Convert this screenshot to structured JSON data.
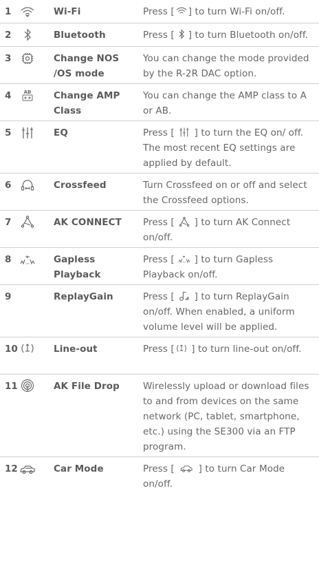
{
  "rows": [
    {
      "num": "1",
      "icon": "wifi-icon",
      "name": "Wi-Fi",
      "desc_pre": "Press [",
      "desc_post": "] to turn Wi-Fi on/off."
    },
    {
      "num": "2",
      "icon": "bluetooth-icon",
      "name": "Bluetooth",
      "desc_pre": "Press [",
      "desc_post": "] to turn Bluetooth on/off."
    },
    {
      "num": "3",
      "icon": "chip-icon",
      "name": "Change NOS /OS mode",
      "desc": "You can change the mode provided by the R-2R DAC option."
    },
    {
      "num": "4",
      "icon": "amp-class-icon",
      "name": "Change AMP Class",
      "desc": "You can change the AMP class to A or AB."
    },
    {
      "num": "5",
      "icon": "eq-icon",
      "name": "EQ",
      "desc_pre": "Press [",
      "desc_post": "] to turn the EQ on/ off. The most recent EQ settings are applied by default."
    },
    {
      "num": "6",
      "icon": "crossfeed-icon",
      "name": "Crossfeed",
      "desc": "Turn Crossfeed on or off and select the Crossfeed options."
    },
    {
      "num": "7",
      "icon": "ak-connect-icon",
      "name": "AK CONNECT",
      "desc_pre": "Press [",
      "desc_post": "] to turn AK Connect on/off."
    },
    {
      "num": "8",
      "icon": "gapless-icon",
      "name": "Gapless Playback",
      "desc_pre": "Press [",
      "desc_post": "] to turn Gapless Playback on/off."
    },
    {
      "num": "9",
      "icon": "replaygain-icon",
      "name": "ReplayGain",
      "desc_pre": "Press [",
      "desc_post": "] to turn ReplayGain on/off. When enabled, a uniform volume level will be applied."
    },
    {
      "num": "10",
      "icon": "line-out-icon",
      "name": "Line-out",
      "desc_pre": "Press [",
      "desc_post": "] to turn line-out on/off."
    },
    {
      "num": "11",
      "icon": "file-drop-icon",
      "name": "AK File Drop",
      "desc": "Wirelessly upload or download files to and from devices on the same network (PC, tablet, smartphone, etc.) using the SE300 via an FTP program."
    },
    {
      "num": "12",
      "icon": "car-icon",
      "name": "Car Mode",
      "desc_pre": "Press [",
      "desc_post": "] to turn Car Mode on/off."
    }
  ]
}
